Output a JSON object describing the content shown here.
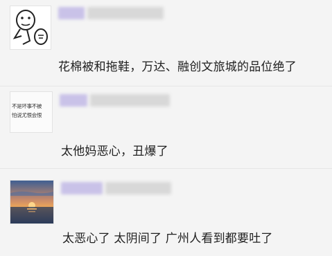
{
  "comments": [
    {
      "text": "花棉被和拖鞋，万达、融创文旅城的品位绝了",
      "avatar_icon": "cartoon-doodle-icon"
    },
    {
      "text": "太他妈恶心，丑爆了",
      "avatar_icon": "handwriting-note-icon",
      "avatar_lines": [
        "不是坏事不被",
        "怕说尤恨会恨"
      ]
    },
    {
      "text": "太恶心了 太阴间了 广州人看到都要吐了",
      "avatar_icon": "sunset-photo-icon"
    }
  ],
  "colors": {
    "name_blur": "#c9c2e8",
    "meta_blur": "#d8d8d8",
    "page_bg": "#f4f4f4",
    "text": "#1f1f1f"
  }
}
